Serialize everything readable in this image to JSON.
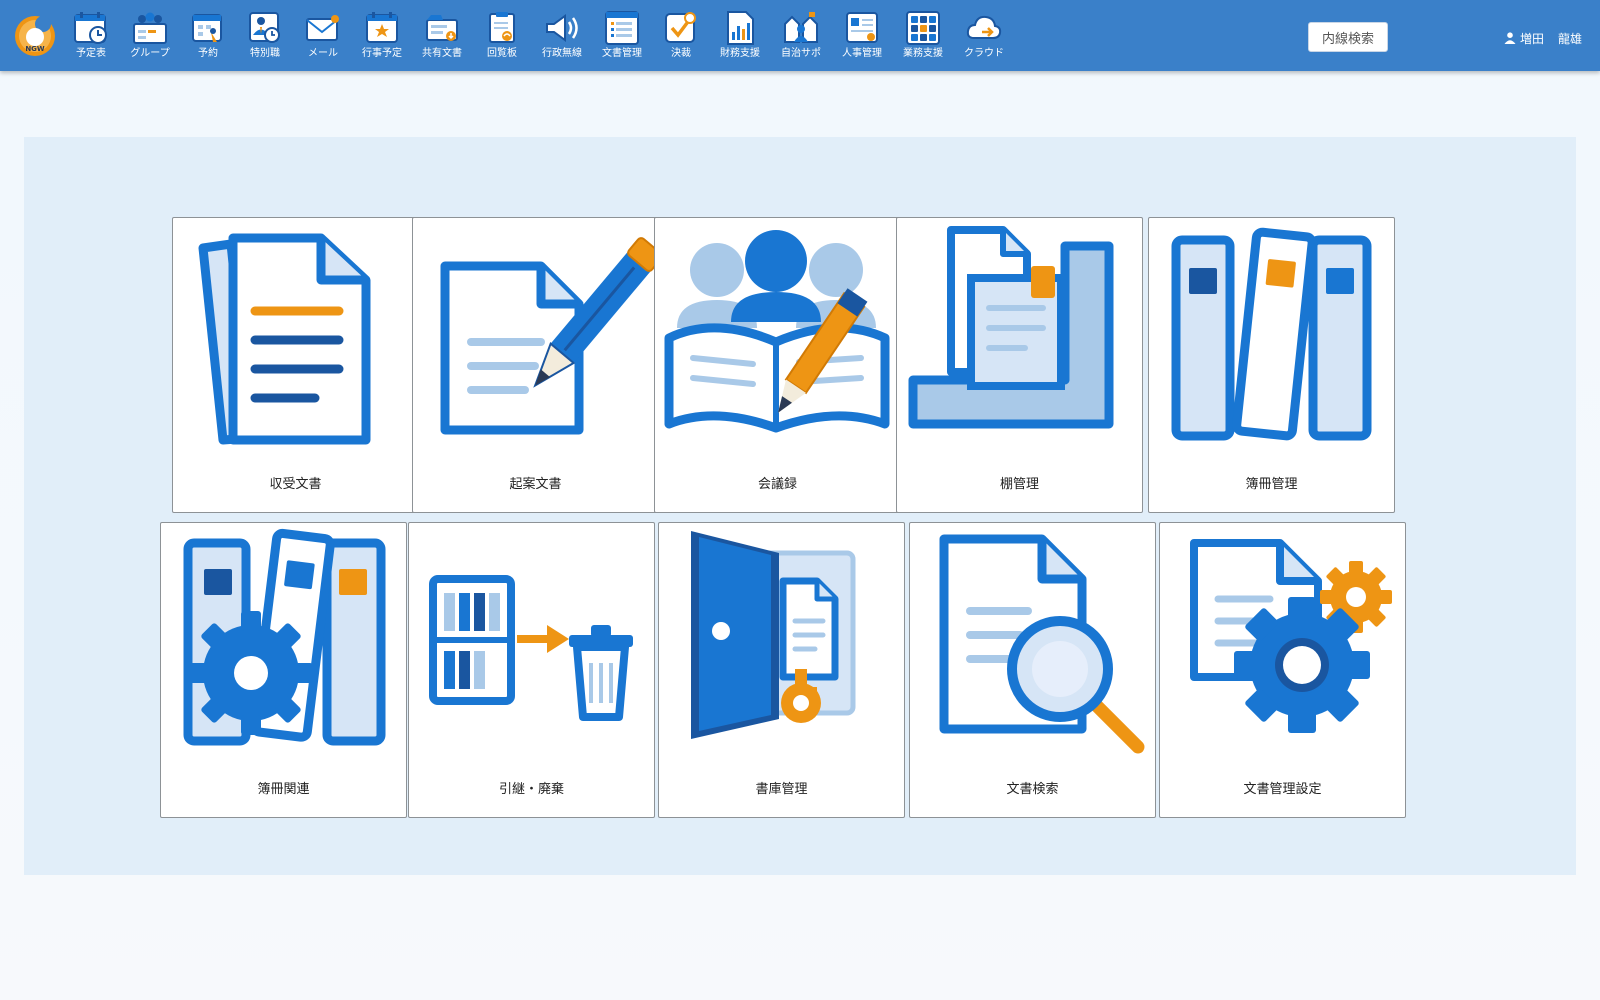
{
  "header": {
    "logo_text": "NGW",
    "apps": [
      {
        "label": "予定表",
        "icon": "calendar-clock-icon"
      },
      {
        "label": "グループ",
        "icon": "group-icon"
      },
      {
        "label": "予約",
        "icon": "reservation-icon"
      },
      {
        "label": "特別職",
        "icon": "special-staff-icon"
      },
      {
        "label": "メール",
        "icon": "mail-icon"
      },
      {
        "label": "行事予定",
        "icon": "event-calendar-icon"
      },
      {
        "label": "共有文書",
        "icon": "shared-docs-icon"
      },
      {
        "label": "回覧板",
        "icon": "circular-board-icon"
      },
      {
        "label": "行政無線",
        "icon": "radio-speaker-icon"
      },
      {
        "label": "文書管理",
        "icon": "document-management-icon"
      },
      {
        "label": "決裁",
        "icon": "approval-icon"
      },
      {
        "label": "財務支援",
        "icon": "finance-chart-icon"
      },
      {
        "label": "自治サポ",
        "icon": "community-icon"
      },
      {
        "label": "人事管理",
        "icon": "personnel-icon"
      },
      {
        "label": "業務支援",
        "icon": "business-grid-icon"
      },
      {
        "label": "クラウド",
        "icon": "cloud-icon"
      }
    ],
    "search_label": "内線検索",
    "user": {
      "last_name": "増田",
      "first_name": "龍雄"
    }
  },
  "menu": [
    {
      "label": "収受文書",
      "icon": "received-document-icon"
    },
    {
      "label": "起案文書",
      "icon": "draft-document-icon"
    },
    {
      "label": "会議録",
      "icon": "meeting-minutes-icon"
    },
    {
      "label": "棚管理",
      "icon": "shelf-management-icon"
    },
    {
      "label": "簿冊管理",
      "icon": "ledger-management-icon"
    },
    {
      "label": "簿冊関連",
      "icon": "ledger-related-icon"
    },
    {
      "label": "引継・廃棄",
      "icon": "transfer-disposal-icon"
    },
    {
      "label": "書庫管理",
      "icon": "archive-management-icon"
    },
    {
      "label": "文書検索",
      "icon": "document-search-icon"
    },
    {
      "label": "文書管理設定",
      "icon": "document-settings-icon"
    }
  ],
  "colors": {
    "header_bg": "#3a80c9",
    "primary_blue": "#1976d2",
    "dark_blue": "#1a56a0",
    "light_blue": "#a9c9e8",
    "pale_blue": "#d6e5f6",
    "accent_orange": "#ee9514",
    "panel_bg": "#e1eef9"
  }
}
